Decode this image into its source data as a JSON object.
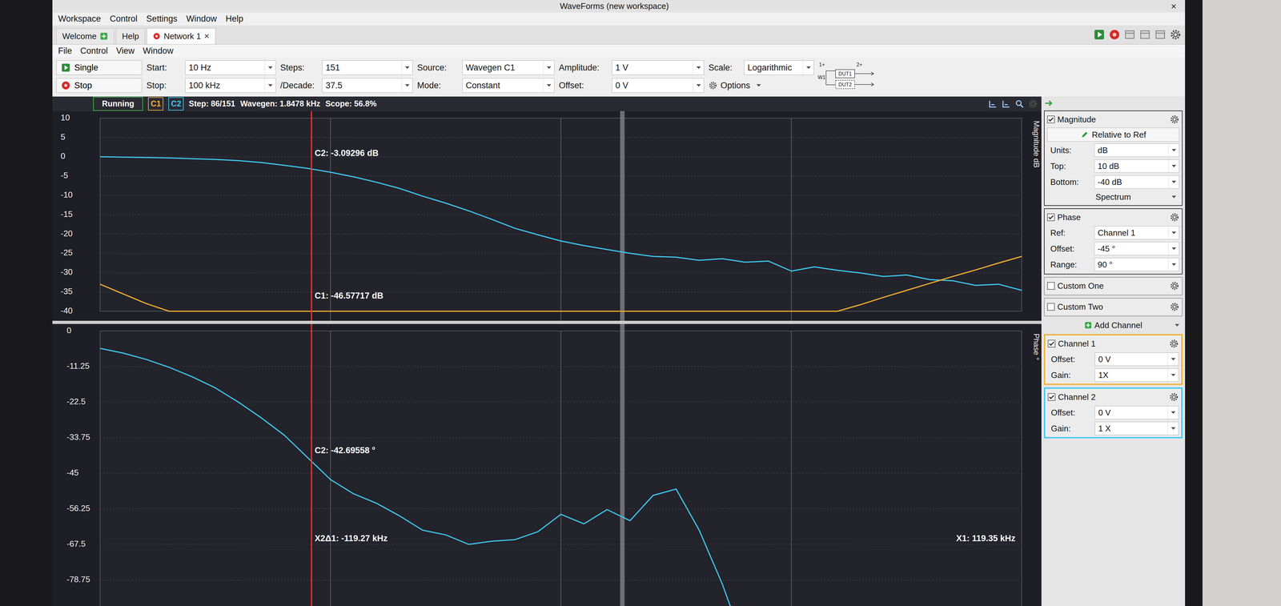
{
  "window": {
    "title": "WaveForms (new workspace)",
    "close": "×"
  },
  "menu": [
    "Workspace",
    "Control",
    "Settings",
    "Window",
    "Help"
  ],
  "tabs": [
    {
      "label": "Welcome",
      "selected": false,
      "kind": "welcome"
    },
    {
      "label": "Help",
      "selected": false,
      "kind": "plain"
    },
    {
      "label": "Network 1",
      "selected": true,
      "kind": "instrument",
      "close": "×"
    }
  ],
  "submenu": [
    "File",
    "Control",
    "View",
    "Window"
  ],
  "sweep": {
    "rows": [
      {
        "button": {
          "label": "Single",
          "kind": "single"
        },
        "fields": [
          {
            "label": "Start:",
            "value": "10 Hz",
            "kind": "dropdown"
          },
          {
            "label": "Steps:",
            "value": "151",
            "kind": "dropdown"
          },
          {
            "label": "Source:",
            "value": "Wavegen C1",
            "kind": "dropdown"
          },
          {
            "label": "Amplitude:",
            "value": "1 V",
            "kind": "dropdown"
          },
          {
            "label": "Scale:",
            "value": "Logarithmic",
            "kind": "dropdown"
          }
        ]
      },
      {
        "button": {
          "label": "Stop",
          "kind": "stop"
        },
        "fields": [
          {
            "label": "Stop:",
            "value": "100 kHz",
            "kind": "dropdown"
          },
          {
            "label": "/Decade:",
            "value": "37.5",
            "kind": "dropdown"
          },
          {
            "label": "Mode:",
            "value": "Constant",
            "kind": "dropdown"
          },
          {
            "label": "Offset:",
            "value": "0 V",
            "kind": "dropdown"
          },
          {
            "value": "Options",
            "kind": "menu"
          }
        ]
      }
    ]
  },
  "dut": {
    "in1": "1+",
    "in2": "2+",
    "source": "W1",
    "dut1": "DUT1",
    "dut2": "DUT2"
  },
  "status": {
    "state": "Running",
    "channels": [
      {
        "label": "C1",
        "color": "#f0b030"
      },
      {
        "label": "C2",
        "color": "#3fc8ee"
      }
    ],
    "items": [
      "Step: 86/151",
      "Wavegen: 1.8478 kHz",
      "Scope: 56.8%"
    ]
  },
  "chart": {
    "x_min_hz": 10,
    "x_max_hz": 100000,
    "points_per_decade": 10,
    "cursor_hz": 82.7,
    "sweep_hz": 1847.8,
    "magnitude": {
      "axis_label": "Magnitude dB",
      "top": 10,
      "bottom": -40,
      "ticks": [
        "10",
        "5",
        "0",
        "-5",
        "-10",
        "-15",
        "-20",
        "-25",
        "-30",
        "-35",
        "-40"
      ],
      "series": [
        {
          "name": "C2",
          "color": "#3fc8ee",
          "values": [
            0,
            -0.1,
            -0.2,
            -0.3,
            -0.5,
            -0.7,
            -1,
            -1.5,
            -2.2,
            -3,
            -4,
            -5.2,
            -6.6,
            -8.2,
            -10.2,
            -12,
            -14,
            -16.2,
            -18.5,
            -20.2,
            -21.8,
            -23,
            -24,
            -25,
            -25.8,
            -26,
            -26.8,
            -26.4,
            -27.3,
            -27,
            -29.6,
            -28.5,
            -29.4,
            -30.1,
            -31,
            -30.6,
            -31.8,
            -32.1,
            -33.3,
            -33,
            -34.6
          ]
        },
        {
          "name": "C1",
          "color": "#f0b030",
          "values": [
            -33,
            -35.5,
            -38,
            -41,
            -43,
            -44.5,
            -45.5,
            -46,
            -46.3,
            -46.6,
            -47,
            -47.3,
            -47.1,
            -47.5,
            -47.2,
            -47.6,
            -47.4,
            -47.8,
            -47.5,
            -47.9,
            -47.6,
            -48,
            -47.7,
            -48.1,
            -47.8,
            -47.9,
            -47.5,
            -47.2,
            -46.8,
            -46,
            -44.5,
            -42.2,
            -40.3,
            -38.3,
            -36.4,
            -34.6,
            -32.8,
            -31,
            -29.3,
            -27.5,
            -25.8
          ]
        }
      ],
      "annotations": [
        {
          "text": "C2: -3.09296 dB",
          "value": -3.09296
        },
        {
          "text": "C1: -46.57717 dB",
          "value": -46.57717
        }
      ]
    },
    "phase": {
      "axis_label": "Phase °",
      "top": 0,
      "bottom": -90,
      "ticks": [
        "0",
        "-11.25",
        "-22.5",
        "-33.75",
        "-45",
        "-56.25",
        "-67.5",
        "-78.75"
      ],
      "series": [
        {
          "name": "C2",
          "color": "#3fc8ee",
          "values": [
            -5.5,
            -7,
            -9,
            -11.5,
            -14.5,
            -18,
            -22.5,
            -27.5,
            -33,
            -40,
            -47,
            -51.5,
            -54.5,
            -58.5,
            -63,
            -64.5,
            -67.5,
            -66.5,
            -66,
            -63.5,
            -58,
            -61,
            -56.5,
            -60,
            -52,
            -50,
            -63,
            -80,
            -100,
            -100,
            -100,
            -100,
            -100,
            -100,
            -100,
            -100,
            -100,
            -100,
            -100,
            -100,
            -100
          ]
        }
      ],
      "annotations": [
        {
          "text": "C2: -42.69558 °",
          "value": -42.69558
        }
      ],
      "x_labels": [
        {
          "text": "X2Δ1: -119.27 kHz",
          "kind": "delta"
        },
        {
          "text": "X1: 119.35 kHz",
          "kind": "cursor"
        }
      ]
    }
  },
  "panel": {
    "groups": [
      {
        "kind": "magnitude",
        "label": "Magnitude",
        "checked": true,
        "button": "Relative to Ref",
        "fields": [
          {
            "label": "Units:",
            "value": "dB"
          },
          {
            "label": "Top:",
            "value": "10 dB"
          },
          {
            "label": "Bottom:",
            "value": "-40 dB"
          }
        ],
        "footer": "Spectrum"
      },
      {
        "kind": "phase",
        "label": "Phase",
        "checked": true,
        "fields": [
          {
            "label": "Ref:",
            "value": "Channel 1"
          },
          {
            "label": "Offset:",
            "value": "-45 °"
          },
          {
            "label": "Range:",
            "value": "90 °"
          }
        ]
      },
      {
        "kind": "custom",
        "label": "Custom One",
        "checked": false
      },
      {
        "kind": "custom",
        "label": "Custom Two",
        "checked": false
      }
    ],
    "add_channel": "Add Channel",
    "channels": [
      {
        "label": "Channel 1",
        "checked": true,
        "color": "#f0b030",
        "fields": [
          {
            "label": "Offset:",
            "value": "0 V"
          },
          {
            "label": "Gain:",
            "value": "1X"
          }
        ]
      },
      {
        "label": "Channel 2",
        "checked": true,
        "color": "#3fc8ee",
        "fields": [
          {
            "label": "Offset:",
            "value": "0 V"
          },
          {
            "label": "Gain:",
            "value": "1 X"
          }
        ]
      }
    ]
  }
}
